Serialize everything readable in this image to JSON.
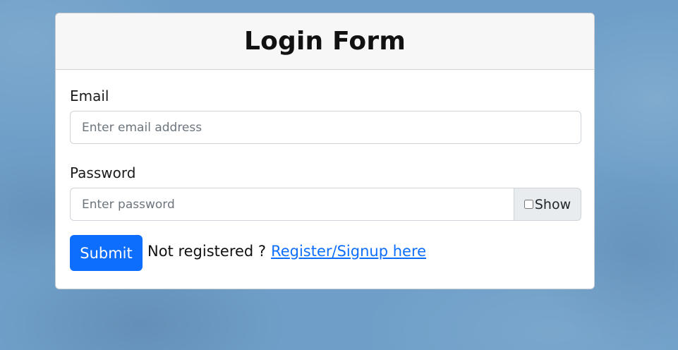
{
  "form": {
    "title": "Login Form",
    "email": {
      "label": "Email",
      "placeholder": "Enter email address",
      "value": ""
    },
    "password": {
      "label": "Password",
      "placeholder": "Enter password",
      "value": "",
      "show_label": "Show",
      "show_checked": false
    },
    "submit_label": "Submit",
    "register_prompt": "Not registered ?",
    "register_link": "Register/Signup here"
  },
  "colors": {
    "background": "#6f9fc8",
    "primary": "#0d6efd",
    "header_bg": "#f7f7f7",
    "addon_bg": "#e9ecef"
  },
  "icons": {
    "show_toggle": "checkbox-icon"
  }
}
